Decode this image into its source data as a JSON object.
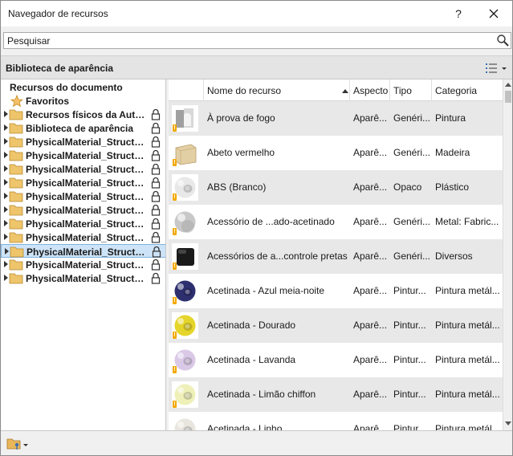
{
  "window": {
    "title": "Navegador de recursos",
    "help_label": "?",
    "close_icon": "close-icon"
  },
  "search": {
    "placeholder": "Pesquisar",
    "icon": "search-icon"
  },
  "library": {
    "title": "Biblioteca de aparência",
    "view_icon": "list-view-icon"
  },
  "tree": {
    "root": "Recursos do documento",
    "favorites": "Favoritos",
    "items": [
      {
        "label": "Recursos físicos da Autodesk"
      },
      {
        "label": "Biblioteca de aparência"
      },
      {
        "label": "PhysicalMaterial_Structural"
      },
      {
        "label": "PhysicalMaterial_Structural"
      },
      {
        "label": "PhysicalMaterial_Structural"
      },
      {
        "label": "PhysicalMaterial_Structural"
      },
      {
        "label": "PhysicalMaterial_Structural"
      },
      {
        "label": "PhysicalMaterial_Structural"
      },
      {
        "label": "PhysicalMaterial_Structural"
      },
      {
        "label": "PhysicalMaterial_Structural"
      },
      {
        "label": "PhysicalMaterial_Structural",
        "selected": true
      },
      {
        "label": "PhysicalMaterial_Structural"
      },
      {
        "label": "PhysicalMaterial_Structural"
      }
    ]
  },
  "grid": {
    "columns": [
      "",
      "Nome do recurso",
      "Aspecto",
      "Tipo",
      "Categoria"
    ],
    "rows": [
      {
        "name": "À prova de fogo",
        "aspect": "Aparê...",
        "type": "Genéri...",
        "category": "Pintura",
        "swatch": "fireproof",
        "color": "#b0b0b0"
      },
      {
        "name": "Abeto vermelho",
        "aspect": "Aparê...",
        "type": "Genéri...",
        "category": "Madeira",
        "swatch": "wood",
        "color": "#e3cfa4"
      },
      {
        "name": "ABS (Branco)",
        "aspect": "Aparê...",
        "type": "Opaco",
        "category": "Plástico",
        "swatch": "ring",
        "color": "#e8e8e8"
      },
      {
        "name": "Acessório de ...ado-acetinado",
        "aspect": "Aparê...",
        "type": "Genéri...",
        "category": "Metal: Fabric...",
        "swatch": "sphere",
        "color": "#c8c8c8"
      },
      {
        "name": "Acessórios de a...controle pretas",
        "aspect": "Aparê...",
        "type": "Genéri...",
        "category": "Diversos",
        "swatch": "cube",
        "color": "#1a1a1a"
      },
      {
        "name": "Acetinada - Azul meia-noite",
        "aspect": "Aparê...",
        "type": "Pintur...",
        "category": "Pintura metál...",
        "swatch": "ring",
        "color": "#2e2f6e"
      },
      {
        "name": "Acetinada - Dourado",
        "aspect": "Aparê...",
        "type": "Pintur...",
        "category": "Pintura metál...",
        "swatch": "ring",
        "color": "#e5d52a"
      },
      {
        "name": "Acetinada - Lavanda",
        "aspect": "Aparê...",
        "type": "Pintur...",
        "category": "Pintura metál...",
        "swatch": "ring",
        "color": "#d9c9e6"
      },
      {
        "name": "Acetinada - Limão chiffon",
        "aspect": "Aparê...",
        "type": "Pintur...",
        "category": "Pintura metál...",
        "swatch": "ring",
        "color": "#eef0b8"
      },
      {
        "name": "Acetinada - Linho",
        "aspect": "Aparê...",
        "type": "Pintur...",
        "category": "Pintura metál...",
        "swatch": "ring",
        "color": "#e8e6de"
      }
    ]
  },
  "footer": {
    "icon": "folder-key-icon"
  }
}
